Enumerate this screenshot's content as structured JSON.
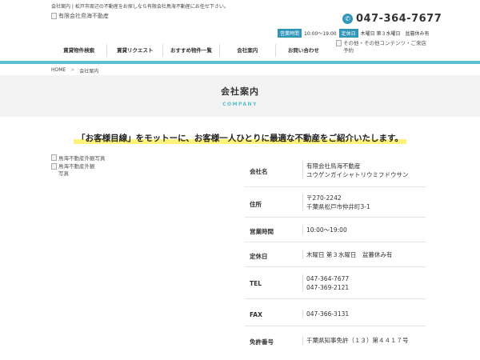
{
  "header": {
    "tagline": "会社案内 | 松戸市周辺の不動産をお探しなら有限会社鳥海不動産にお任せ下さい。",
    "logo_alt": "有限会社鳥海不動産",
    "phone": "047-364-7677",
    "hours_badge": "営業時間",
    "hours_value": "10:00～19:00",
    "holiday_badge": "定休日",
    "holiday_value": "木曜日 第３水曜日　盆暮休み有",
    "sub_links_alt": "その他・その他コンテンツ・ご来店予約"
  },
  "nav": {
    "items": [
      "賃貸物件検索",
      "賃貸リクエスト",
      "おすすめ物件一覧",
      "会社案内",
      "お問い合わせ"
    ]
  },
  "breadcrumb": {
    "home": "HOME",
    "separator": ">",
    "current": "会社案内"
  },
  "page": {
    "title": "会社案内",
    "subtitle": "COMPANY",
    "motto": "「お客様目線」をモットーに、お客様一人ひとりに最適な不動産をご紹介いたします。",
    "photo1_alt": "鳥海不動産外観写真",
    "photo2_alt": "鳥海不動産外観写真"
  },
  "company": {
    "name_label": "会社名",
    "name_line1": "有限会社鳥海不動産",
    "name_line2": "ユウゲンガイシャトリウミフドウサン",
    "address_label": "住所",
    "address_line1": "〒270-2242",
    "address_line2": "千葉県松戸市仲井町3-1",
    "hours_label": "営業時間",
    "hours_value": "10:00〜19:00",
    "holiday_label": "定休日",
    "holiday_value": "木曜日 第３水曜日　盆暮休み有",
    "tel_label": "TEL",
    "tel_line1": "047-364-7677",
    "tel_line2": "047-369-2121",
    "fax_label": "FAX",
    "fax_value": "047-366-3131",
    "license_label": "免許番号",
    "license_value": "千葉県知事免許（１３）第４４１７号"
  },
  "colors": {
    "accent": "#2f95b9",
    "bar": "#5bbfd1",
    "highlight": "#fff27a"
  },
  "icons": {
    "phone": "phone-icon",
    "broken_image": "broken-image-icon",
    "chevron": "chevron-right-icon"
  }
}
